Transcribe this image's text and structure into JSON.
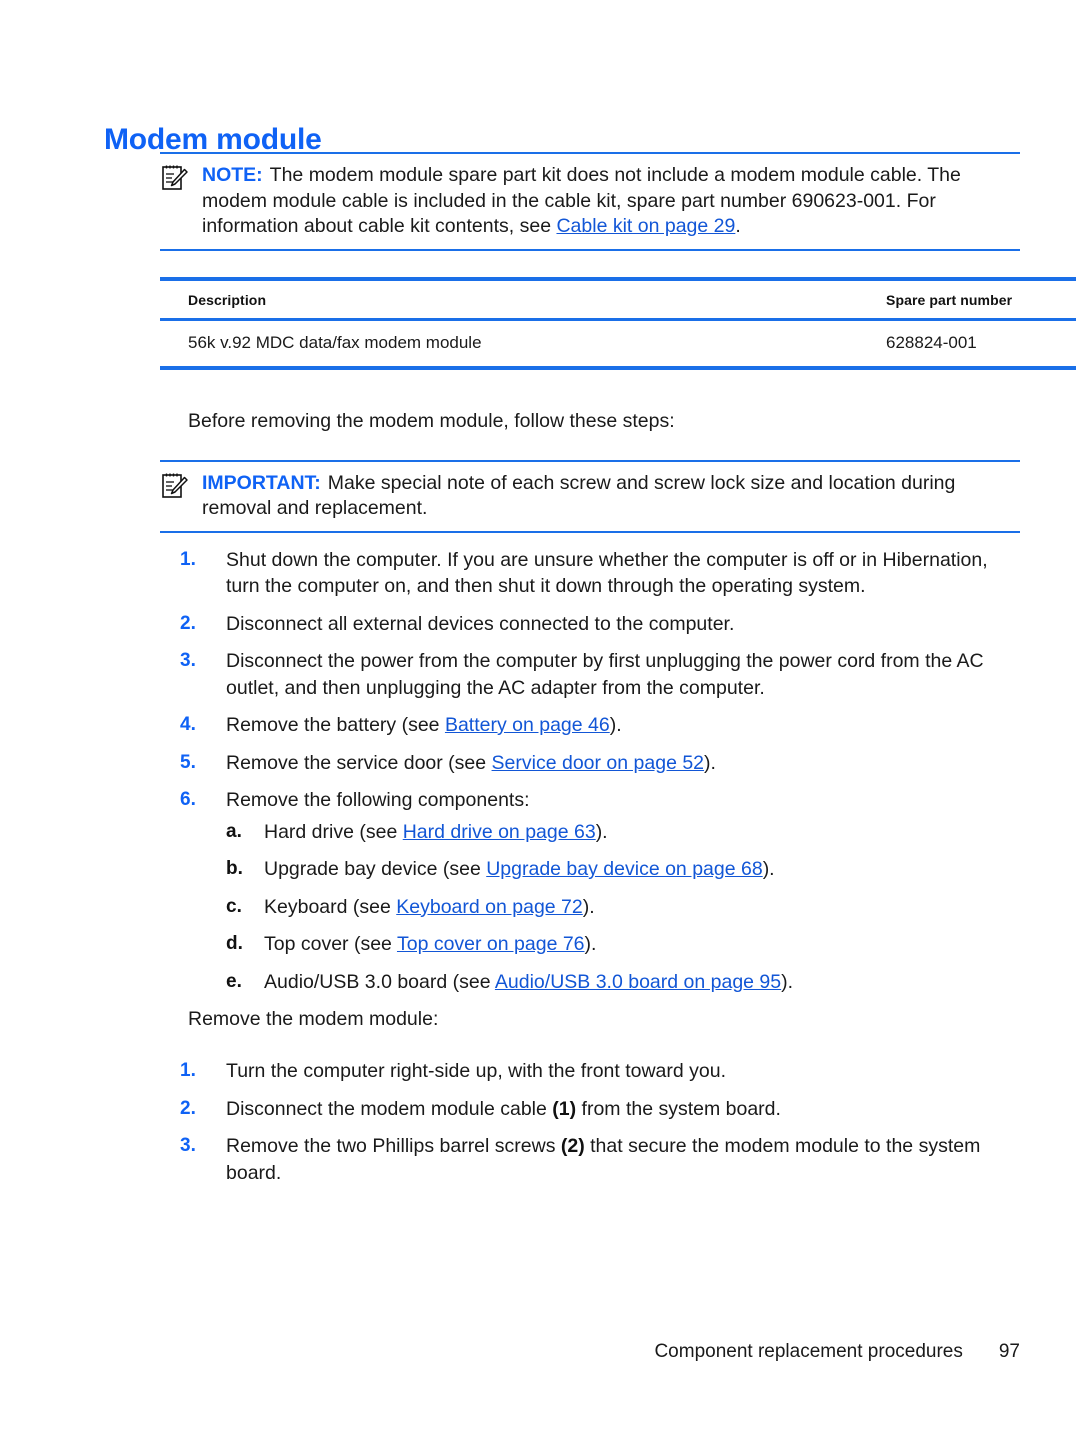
{
  "document": {
    "title": "Modem module",
    "footer": {
      "section": "Component replacement procedures",
      "page_number": "97"
    },
    "colors": {
      "heading_blue": "#0f62f5",
      "rule_blue": "#1a6fe8",
      "link_blue": "#1256d6",
      "text_black": "#1a1a1a",
      "background": "#ffffff"
    }
  },
  "note": {
    "label": "NOTE:",
    "icon": "note-pencil-icon",
    "text_part1": "The modem module spare part kit does not include a modem module cable. The modem module cable is included in the cable kit, spare part number 690623-001. For information about cable kit contents, see ",
    "link": "Cable kit on page 29",
    "text_part2": "."
  },
  "parts_table": {
    "headers": [
      "Description",
      "Spare part number"
    ],
    "rows": [
      {
        "description": "56k v.92 MDC data/fax modem module",
        "spare_part_number": "628824-001"
      }
    ]
  },
  "intro_paragraph": "Before removing the modem module, follow these steps:",
  "important": {
    "label": "IMPORTANT:",
    "icon": "note-pencil-icon",
    "text": "Make special note of each screw and screw lock size and location during removal and replacement."
  },
  "prep_steps": [
    {
      "marker": "1.",
      "text": "Shut down the computer. If you are unsure whether the computer is off or in Hibernation, turn the computer on, and then shut it down through the operating system."
    },
    {
      "marker": "2.",
      "text": "Disconnect all external devices connected to the computer."
    },
    {
      "marker": "3.",
      "text": "Disconnect the power from the computer by first unplugging the power cord from the AC outlet, and then unplugging the AC adapter from the computer."
    },
    {
      "marker": "4.",
      "text_before": "Remove the battery (see ",
      "link": "Battery on page 46",
      "text_after": ")."
    },
    {
      "marker": "5.",
      "text_before": "Remove the service door (see ",
      "link": "Service door on page 52",
      "text_after": ")."
    },
    {
      "marker": "6.",
      "text": "Remove the following components:"
    }
  ],
  "components_substeps": [
    {
      "marker": "a.",
      "text_before": "Hard drive (see ",
      "link": "Hard drive on page 63",
      "text_after": ")."
    },
    {
      "marker": "b.",
      "text_before": "Upgrade bay device (see ",
      "link": "Upgrade bay device on page 68",
      "text_after": ")."
    },
    {
      "marker": "c.",
      "text_before": "Keyboard (see ",
      "link": "Keyboard on page 72",
      "text_after": ")."
    },
    {
      "marker": "d.",
      "text_before": "Top cover (see ",
      "link": "Top cover on page 76",
      "text_after": ")."
    },
    {
      "marker": "e.",
      "text_before": "Audio/USB 3.0 board (see ",
      "link": "Audio/USB 3.0 board on page 95",
      "text_after": ")."
    }
  ],
  "removal_intro": "Remove the modem module:",
  "removal_steps": [
    {
      "marker": "1.",
      "text": "Turn the computer right-side up, with the front toward you."
    },
    {
      "marker": "2.",
      "text_before": "Disconnect the modem module cable ",
      "callout": "(1)",
      "text_after": " from the system board."
    },
    {
      "marker": "3.",
      "text_before": "Remove the two Phillips barrel screws ",
      "callout": "(2)",
      "text_after": " that secure the modem module to the system board."
    }
  ]
}
